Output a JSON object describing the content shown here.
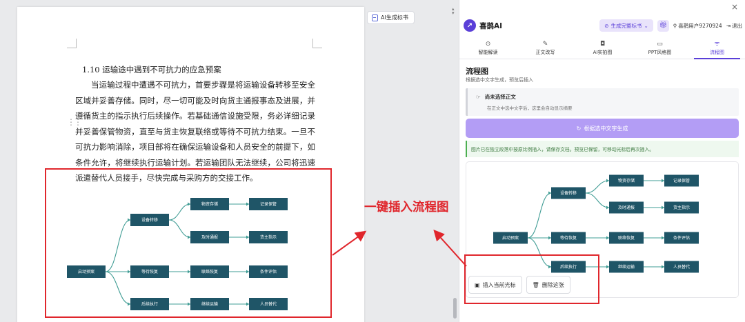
{
  "document": {
    "heading": "1.10 运输途中遇到不可抗力的应急预案",
    "paragraph": "当运输过程中遭遇不可抗力，首要步骤是将运输设备转移至安全区域并妥善存储。同时，尽一切可能及时向货主通报事态及进展，并遵循货主的指示执行后续操作。若基础通信设施受限，务必详细记录并妥善保管物资，直至与货主恢复联络或等待不可抗力结束。一旦不可抗力影响消除，项目部将在确保运输设备和人员安全的前提下，如条件允许，将继续执行运输计划。若运输团队无法继续，公司将迅速派遣替代人员接手，尽快完成与采购方的交接工作。",
    "ai_tender_label": "AI生成标书"
  },
  "flowchart": {
    "nodes": [
      {
        "id": "start",
        "label": "启动预案"
      },
      {
        "id": "transfer",
        "label": "设备转移"
      },
      {
        "id": "wait",
        "label": "等待恢复"
      },
      {
        "id": "continue",
        "label": "后续执行"
      },
      {
        "id": "storage",
        "label": "物资存储"
      },
      {
        "id": "report",
        "label": "及时通报"
      },
      {
        "id": "contact",
        "label": "联络恢复"
      },
      {
        "id": "resume",
        "label": "继续运输"
      },
      {
        "id": "record",
        "label": "记录保管"
      },
      {
        "id": "instruct",
        "label": "货主指示"
      },
      {
        "id": "assess",
        "label": "条件评估"
      },
      {
        "id": "replace",
        "label": "人员替代"
      }
    ],
    "edges": [
      [
        "start",
        "transfer"
      ],
      [
        "start",
        "wait"
      ],
      [
        "start",
        "continue"
      ],
      [
        "transfer",
        "storage"
      ],
      [
        "transfer",
        "report"
      ],
      [
        "wait",
        "contact"
      ],
      [
        "continue",
        "resume"
      ],
      [
        "storage",
        "record"
      ],
      [
        "report",
        "instruct"
      ],
      [
        "contact",
        "assess"
      ],
      [
        "resume",
        "replace"
      ]
    ]
  },
  "annotation": {
    "text": "一键插入流程图"
  },
  "panel": {
    "brand": "喜鹊AI",
    "generate_full_label": "生成完整标书",
    "user_label": "喜鹊用户9270924",
    "logout_label": "退出",
    "tabs": [
      {
        "label": "智能解读",
        "icon": "search-icon"
      },
      {
        "label": "正文改写",
        "icon": "edit-icon"
      },
      {
        "label": "AI实拍图",
        "icon": "camera-icon"
      },
      {
        "label": "PPT风格图",
        "icon": "monitor-icon"
      },
      {
        "label": "流程图",
        "icon": "flow-icon"
      }
    ],
    "section_title": "流程图",
    "section_subtitle": "根据选中文字生成，预览后插入",
    "no_selection_title": "尚未选择正文",
    "no_selection_desc": "在正文中选中文字后，这里会自动显示摘要",
    "generate_button": "根据选中文字生成",
    "notice": "图片已在独立段落中按原比例插入，请保存文档。预览已保留，可移动光标后再次插入。",
    "insert_button": "插入当前光标",
    "delete_button": "删除这张"
  },
  "colors": {
    "accent": "#5a3fd8",
    "node": "#1f5567",
    "edge": "#3f9c94",
    "highlight": "#e0262c"
  }
}
